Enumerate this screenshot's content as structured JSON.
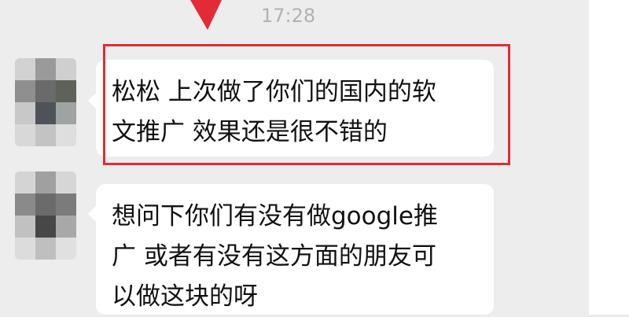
{
  "chat": {
    "timestamp": "17:28",
    "messages": [
      {
        "avatar": "pixelated-contact-avatar",
        "text": "松松 上次做了你们的国内的软\n文推广 效果还是很不错的",
        "highlighted": true
      },
      {
        "avatar": "pixelated-contact-avatar",
        "text": "想问下你们有没有做google推\n广 或者有没有这方面的朋友可\n以做这块的呀",
        "highlighted": false
      }
    ]
  },
  "colors": {
    "background": "#ededed",
    "bubble": "#ffffff",
    "timestamp": "#b2b2b2",
    "highlight": "#e32b35"
  },
  "icons": {
    "annotation_arrow": "red-arrow-icon"
  }
}
